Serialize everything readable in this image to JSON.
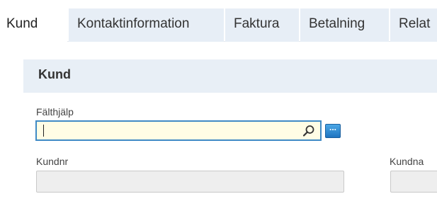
{
  "tabs": [
    {
      "label": "Kund",
      "active": true
    },
    {
      "label": "Kontaktinformation",
      "active": false
    },
    {
      "label": "Faktura",
      "active": false
    },
    {
      "label": "Betalning",
      "active": false
    },
    {
      "label": "Relat",
      "active": false
    }
  ],
  "panel": {
    "title": "Kund",
    "field_help": {
      "label": "Fälthjälp",
      "value": "",
      "search_icon": "search-icon",
      "more_button_label": "..."
    },
    "customer_number": {
      "label": "Kundnr",
      "value": ""
    },
    "customer_name": {
      "label": "Kundna",
      "value": ""
    }
  },
  "colors": {
    "tab_inactive_bg": "#e7eef6",
    "panel_header_bg": "#e8eff6",
    "focus_border": "#3f8ac5",
    "input_focus_bg": "#fffde5",
    "more_button": "#2a86d1"
  }
}
